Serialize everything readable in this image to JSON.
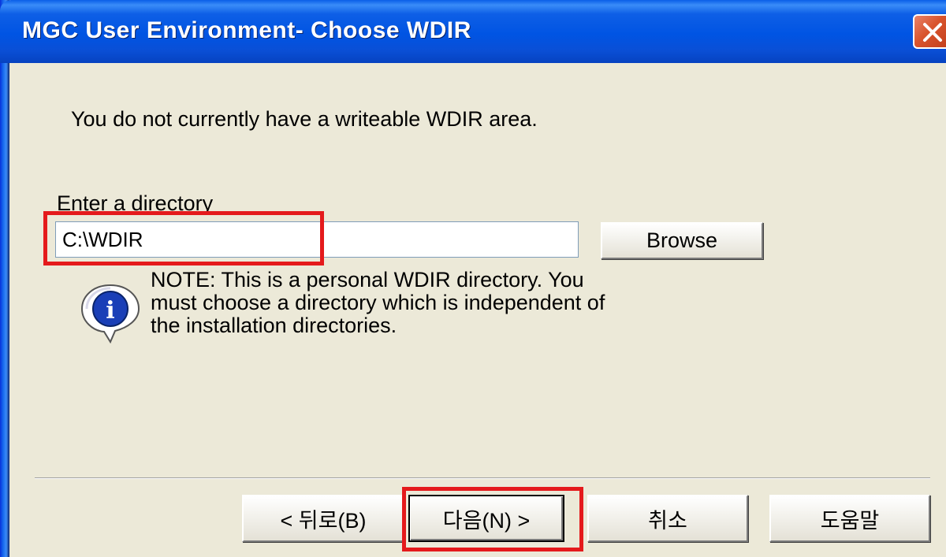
{
  "window": {
    "title": "MGC User Environment- Choose WDIR"
  },
  "message": "You do not currently have a writeable WDIR area.",
  "directory": {
    "label": "Enter a directory",
    "value": "C:\\WDIR"
  },
  "browse_label": "Browse",
  "note": {
    "lines": [
      "NOTE: This is a personal WDIR directory. You",
      "must choose a directory which is independent of",
      "the installation directories."
    ],
    "icon": "info-icon"
  },
  "buttons": {
    "back": "< 뒤로(B)",
    "next": "다음(N) >",
    "cancel": "취소",
    "help": "도움말"
  },
  "colors": {
    "titlebar": "#0054E3",
    "highlight": "#E41A1C",
    "close": "#D9542D",
    "dialog_bg": "#ECE9D8"
  }
}
